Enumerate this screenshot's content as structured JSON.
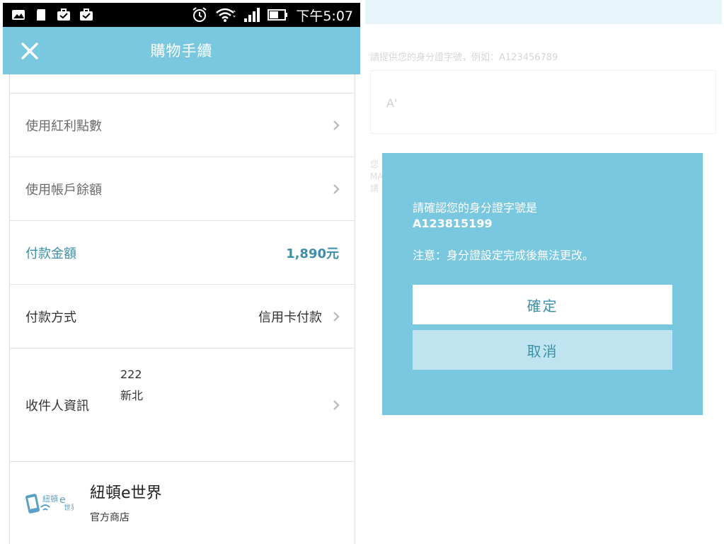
{
  "left": {
    "status_bar": {
      "time": "下午5:07",
      "icons": [
        "image-icon",
        "sd-card-icon",
        "briefcase-icon",
        "briefcase-icon",
        "alarm-icon",
        "wifi-icon",
        "signal-icon",
        "battery-icon"
      ]
    },
    "app_bar": {
      "title": "購物手續",
      "close_icon": "close-icon"
    },
    "rows": {
      "bonus": {
        "label": "使用紅利點數"
      },
      "balance": {
        "label": "使用帳戶餘額"
      },
      "payment_amount": {
        "label": "付款金額",
        "value": "1,890元"
      },
      "payment_method": {
        "label": "付款方式",
        "value": "信用卡付款"
      },
      "recipient": {
        "label": "收件人資訊",
        "line1": "222",
        "line2": "新北"
      }
    },
    "store": {
      "name": "紐頓e世界",
      "subtitle": "官方商店",
      "logo_text": "紐頓e世界"
    }
  },
  "right": {
    "hint": "請提供您的身分證字號，例如：A123456789",
    "input_value": "A'",
    "fragments": [
      "您",
      "MA",
      "請"
    ],
    "dialog": {
      "message": "請確認您的身分證字號是",
      "id_number": "A123815199",
      "note": "注意：身分證設定完成後無法更改。",
      "confirm_label": "確定",
      "cancel_label": "取消"
    }
  },
  "colors": {
    "accent": "#79c8e0",
    "accent_text": "#3d8ea8",
    "cancel_bg": "#bfe4f0"
  }
}
